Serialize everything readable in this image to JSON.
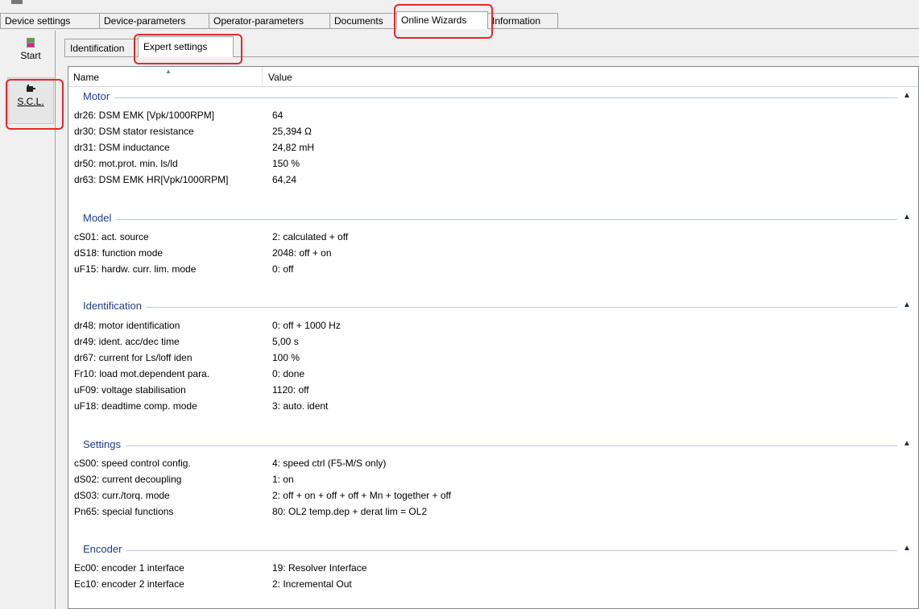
{
  "top_tabs": [
    {
      "label": "Device settings"
    },
    {
      "label": "Device-parameters"
    },
    {
      "label": "Operator-parameters"
    },
    {
      "label": "Documents"
    },
    {
      "label": "Online Wizards"
    },
    {
      "label": "Information"
    }
  ],
  "nav": {
    "start_label": "Start",
    "scl_label": "S.C.L."
  },
  "sub_tabs": [
    {
      "label": "Identification"
    },
    {
      "label": "Expert settings"
    }
  ],
  "grid": {
    "col_name": "Name",
    "col_value": "Value",
    "groups": [
      {
        "title": "Motor",
        "rows": [
          {
            "name": "dr26: DSM EMK [Vpk/1000RPM]",
            "value": "64"
          },
          {
            "name": "dr30: DSM stator resistance",
            "value": "25,394 Ω"
          },
          {
            "name": "dr31: DSM inductance",
            "value": "24,82 mH"
          },
          {
            "name": "dr50: mot.prot. min. ls/ld",
            "value": "150 %"
          },
          {
            "name": "dr63: DSM EMK HR[Vpk/1000RPM]",
            "value": "64,24"
          }
        ]
      },
      {
        "title": "Model",
        "rows": [
          {
            "name": "cS01: act. source",
            "value": "2: calculated + off"
          },
          {
            "name": "dS18: function mode",
            "value": "2048: off + on"
          },
          {
            "name": "uF15: hardw. curr. lim. mode",
            "value": "0: off"
          }
        ]
      },
      {
        "title": "Identification",
        "rows": [
          {
            "name": "dr48: motor identification",
            "value": "0: off + 1000 Hz"
          },
          {
            "name": "dr49: ident. acc/dec time",
            "value": "5,00 s"
          },
          {
            "name": "dr67: current for Ls/loff iden",
            "value": "100 %"
          },
          {
            "name": "Fr10: load mot.dependent para.",
            "value": "0: done"
          },
          {
            "name": "uF09: voltage stabilisation",
            "value": "1120: off"
          },
          {
            "name": "uF18: deadtime comp. mode",
            "value": "3: auto. ident"
          }
        ]
      },
      {
        "title": "Settings",
        "rows": [
          {
            "name": "cS00: speed control config.",
            "value": "4: speed ctrl (F5-M/S only)"
          },
          {
            "name": "dS02: current decoupling",
            "value": "1: on"
          },
          {
            "name": "dS03: curr./torq. mode",
            "value": "2: off + on + off + off + Mn + together + off"
          },
          {
            "name": "Pn65: special functions",
            "value": "80: OL2 temp.dep + derat lim = OL2"
          }
        ]
      },
      {
        "title": "Encoder",
        "rows": [
          {
            "name": "Ec00: encoder 1 interface",
            "value": "19: Resolver Interface"
          },
          {
            "name": "Ec10: encoder 2 interface",
            "value": "2: Incremental Out"
          }
        ]
      }
    ]
  },
  "colors": {
    "group_title": "#1e3d8f",
    "callout": "#e8262a"
  },
  "icons": {
    "start": "keb-drive-icon",
    "scl": "motor-icon",
    "collapse": "chevron-up-icon",
    "sort": "sort-ascending-icon"
  }
}
